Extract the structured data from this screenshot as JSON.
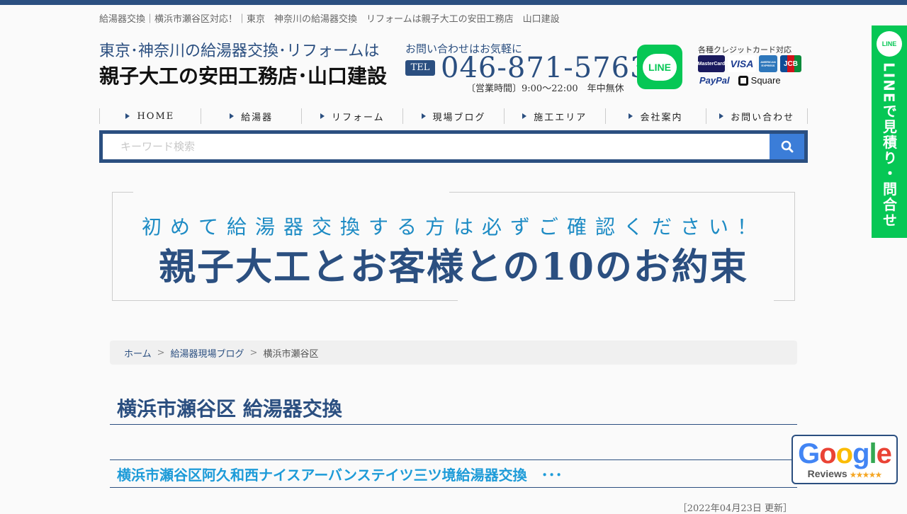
{
  "tagline": "給湯器交換｜横浜市瀬谷区対応！｜東京　神奈川の給湯器交換　リフォームは親子大工の安田工務店　山口建設",
  "logo": {
    "line1": "東京･神奈川の給湯器交換･リフォームは",
    "line2": "親子大工の安田工務店･山口建設"
  },
  "contact": {
    "inquiry": "お問い合わせはお気軽に",
    "tel_badge": "TEL",
    "phone": "046-871-5763",
    "hours": "〔営業時間〕9:00～22:00　年中無休"
  },
  "line_button": {
    "label": "LINE"
  },
  "payments": {
    "title": "各種クレジットカード対応",
    "cards": [
      "MasterCard",
      "VISA",
      "AMERICAN EXPRESS",
      "JCB"
    ],
    "paypal": "PayPal",
    "square": "Square"
  },
  "nav": [
    {
      "label": "HOME"
    },
    {
      "label": "給湯器"
    },
    {
      "label": "リフォーム"
    },
    {
      "label": "現場ブログ"
    },
    {
      "label": "施工エリア"
    },
    {
      "label": "会社案内"
    },
    {
      "label": "お問い合わせ"
    }
  ],
  "search": {
    "placeholder": "キーワード検索",
    "value": ""
  },
  "banner": {
    "sub": "初めて給湯器交換する方は必ずご確認ください！",
    "main": "親子大工とお客様との10のお約束"
  },
  "side_line": {
    "icon_label": "LINE",
    "text": "LINEで見積り・問合せ"
  },
  "breadcrumb": {
    "home": "ホーム",
    "blog": "給湯器現場ブログ",
    "current": "横浜市瀬谷区",
    "separator": ">"
  },
  "page_title": "横浜市瀬谷区 給湯器交換",
  "post": {
    "title": "横浜市瀬谷区阿久和西ナイスアーバンステイツ三ツ境給湯器交換　･･･",
    "date": "［2022年04月23日 更新］"
  },
  "google_reviews": {
    "word": "Google",
    "label": "Reviews",
    "stars": "★★★★★"
  },
  "colors": {
    "brand_navy": "#2b4f80",
    "line_green": "#06c755",
    "link_blue": "#1d9bd8",
    "search_blue": "#3b7dd8"
  }
}
